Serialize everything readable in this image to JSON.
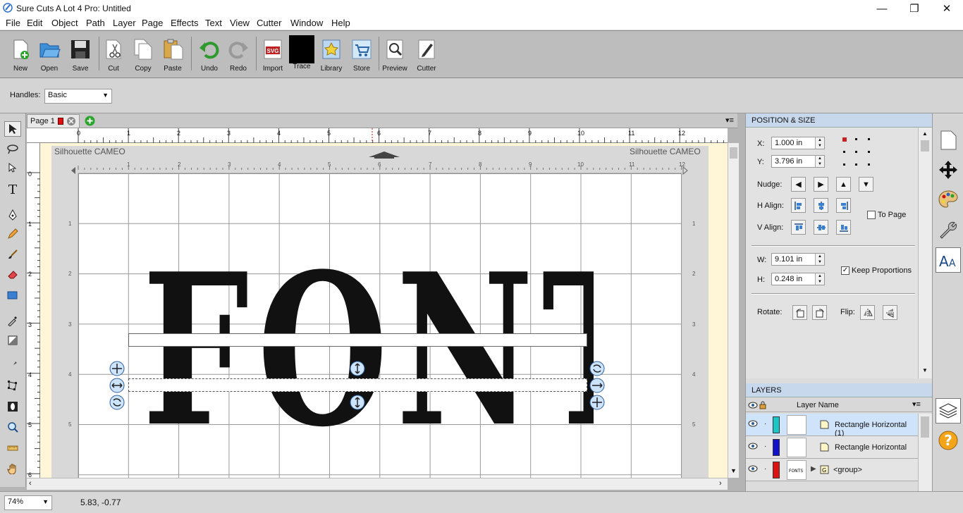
{
  "window": {
    "title": "Sure Cuts A Lot 4 Pro: Untitled"
  },
  "menu": [
    "File",
    "Edit",
    "Object",
    "Path",
    "Layer",
    "Page",
    "Effects",
    "Text",
    "View",
    "Cutter",
    "Window",
    "Help"
  ],
  "toolbar": [
    {
      "label": "New",
      "icon": "new-document-icon"
    },
    {
      "label": "Open",
      "icon": "open-folder-icon"
    },
    {
      "label": "Save",
      "icon": "floppy-disk-icon"
    },
    {
      "label": "Cut",
      "icon": "scissors-icon"
    },
    {
      "label": "Copy",
      "icon": "copy-icon"
    },
    {
      "label": "Paste",
      "icon": "paste-icon"
    },
    {
      "label": "Undo",
      "icon": "undo-arrow-icon"
    },
    {
      "label": "Redo",
      "icon": "redo-arrow-icon"
    },
    {
      "label": "Import",
      "icon": "svg-import-icon"
    },
    {
      "label": "Trace",
      "icon": "trace-icon"
    },
    {
      "label": "Library",
      "icon": "library-star-icon"
    },
    {
      "label": "Store",
      "icon": "cart-icon"
    },
    {
      "label": "Preview",
      "icon": "magnifier-icon"
    },
    {
      "label": "Cutter",
      "icon": "cutter-pen-icon"
    }
  ],
  "options": {
    "handles_label": "Handles:",
    "handles_value": "Basic"
  },
  "page_tab": {
    "label": "Page 1"
  },
  "canvas": {
    "machine_left": "Silhouette CAMEO",
    "machine_right": "Silhouette CAMEO",
    "ruler_h": [
      "0",
      "1",
      "2",
      "3",
      "4",
      "5",
      "6",
      "7",
      "8",
      "9",
      "10",
      "11",
      "12"
    ],
    "ruler_inner": [
      "1",
      "2",
      "3",
      "4",
      "5",
      "6",
      "7",
      "8",
      "9",
      "10",
      "11",
      "12"
    ],
    "ruler_v": [
      "0",
      "1",
      "2",
      "3",
      "4",
      "5",
      "6"
    ],
    "ruler_v_inner": [
      "1",
      "2",
      "3",
      "4",
      "5"
    ],
    "art_text": "FONTS"
  },
  "position_size": {
    "header": "POSITION & SIZE",
    "x_label": "X:",
    "x_value": "1.000 in",
    "y_label": "Y:",
    "y_value": "3.796 in",
    "nudge_label": "Nudge:",
    "halign_label": "H Align:",
    "valign_label": "V Align:",
    "to_page_label": "To Page",
    "w_label": "W:",
    "w_value": "9.101 in",
    "h_label": "H:",
    "h_value": "0.248 in",
    "keep_label": "Keep Proportions",
    "rotate_label": "Rotate:",
    "flip_label": "Flip:"
  },
  "layers": {
    "header": "LAYERS",
    "col_name": "Layer Name",
    "rows": [
      {
        "name": "Rectangle Horizontal (1)",
        "color": "#1ac6c6",
        "selected": true
      },
      {
        "name": "Rectangle Horizontal",
        "color": "#1111cc",
        "selected": false
      },
      {
        "name": "<group>",
        "color": "#dd1111",
        "selected": false
      }
    ]
  },
  "status": {
    "zoom": "74%",
    "coords": "5.83, -0.77"
  }
}
